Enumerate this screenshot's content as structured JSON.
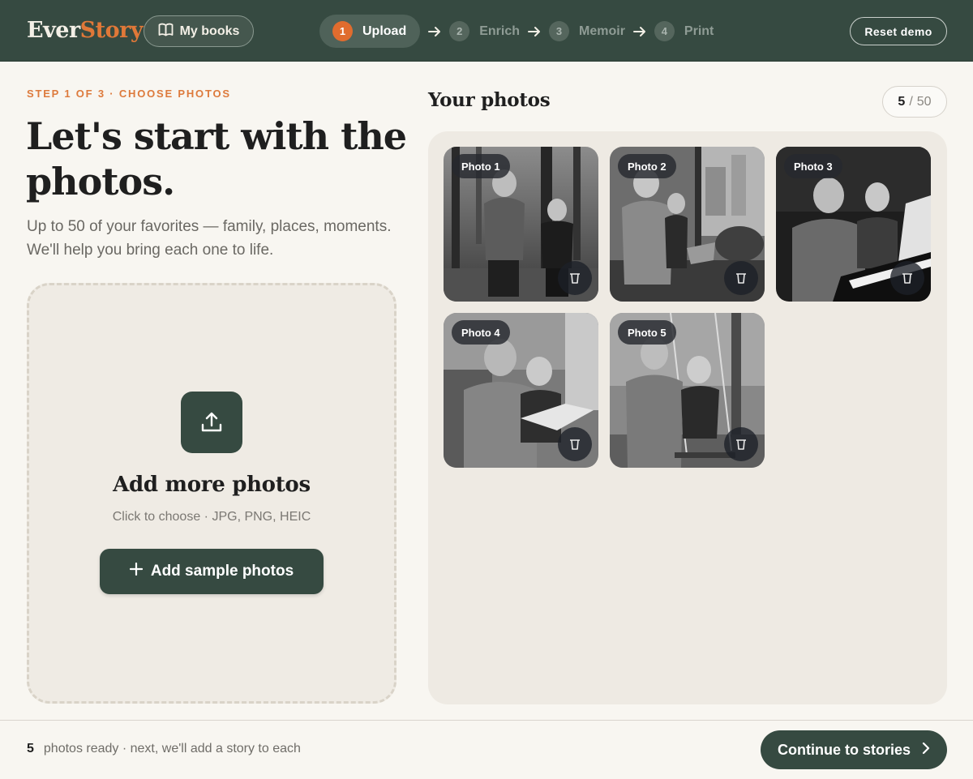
{
  "header": {
    "logo_part1": "Ever",
    "logo_part2": "Story",
    "my_books_label": "My books",
    "steps": [
      {
        "num": "1",
        "label": "Upload",
        "active": true
      },
      {
        "num": "2",
        "label": "Enrich",
        "active": false
      },
      {
        "num": "3",
        "label": "Memoir",
        "active": false
      },
      {
        "num": "4",
        "label": "Print",
        "active": false
      }
    ],
    "reset_label": "Reset demo"
  },
  "intro": {
    "eyebrow": "STEP 1 OF 3 · CHOOSE PHOTOS",
    "headline": "Let's start with the photos.",
    "subhead": "Up to 50 of your favorites — family, places, moments. We'll help you bring each one to life."
  },
  "dropzone": {
    "icon": "upload-icon",
    "title": "Add more photos",
    "hint": "Click to choose · JPG, PNG, HEIC",
    "sample_button": "Add sample photos"
  },
  "gallery": {
    "title": "Your photos",
    "count": "5",
    "max": "50",
    "separator": "/",
    "photos": [
      {
        "label": "Photo 1"
      },
      {
        "label": "Photo 2"
      },
      {
        "label": "Photo 3"
      },
      {
        "label": "Photo 4"
      },
      {
        "label": "Photo 5"
      }
    ]
  },
  "footer": {
    "ready_count": "5",
    "ready_text": "photos ready · next, we'll add a story to each",
    "continue_label": "Continue to stories"
  },
  "colors": {
    "brand_green": "#364a41",
    "accent_orange": "#e06c2e",
    "background": "#f8f6f1"
  }
}
